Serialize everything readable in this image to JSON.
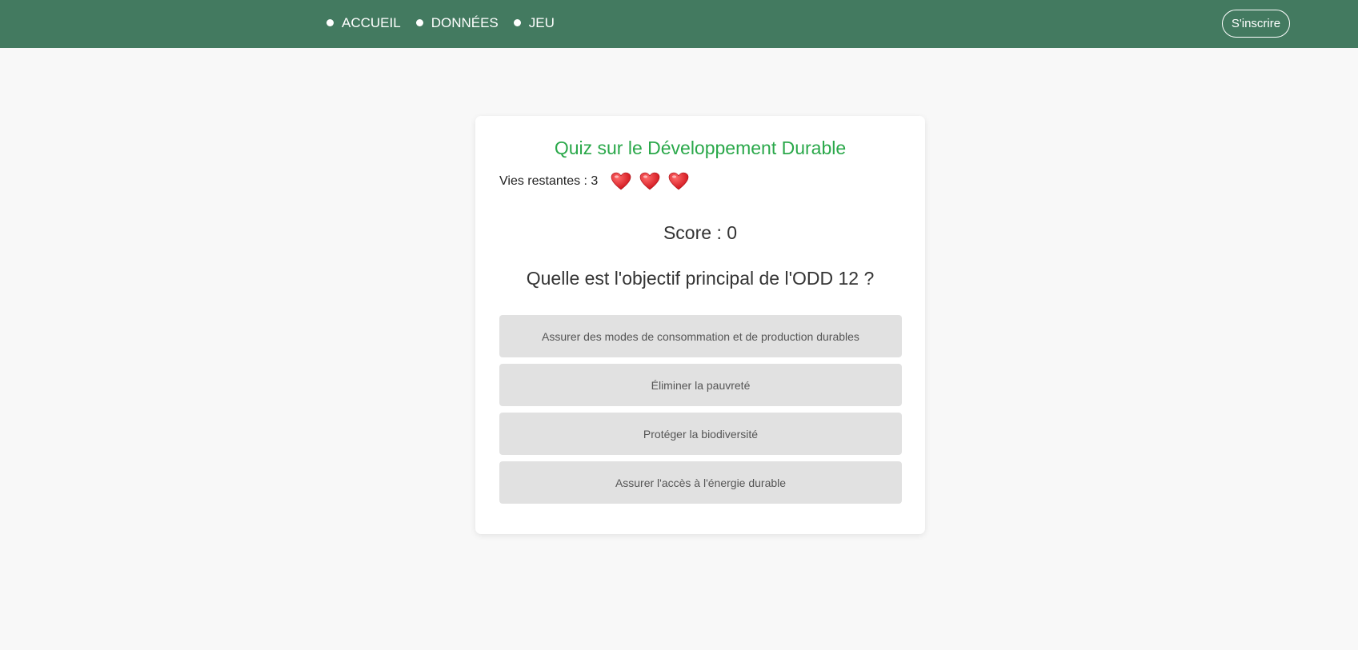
{
  "nav": {
    "items": [
      {
        "label": "ACCUEIL"
      },
      {
        "label": "DONNÉES"
      },
      {
        "label": "JEU"
      }
    ],
    "signup_label": "S'inscrire"
  },
  "quiz": {
    "title": "Quiz sur le Développement Durable",
    "lives_label": "Vies restantes : 3",
    "lives_remaining": 3,
    "score_label": "Score : 0",
    "question": "Quelle est l'objectif principal de l'ODD 12 ?",
    "answers": [
      {
        "label": "Assurer des modes de consommation et de production durables"
      },
      {
        "label": "Éliminer la pauvreté"
      },
      {
        "label": "Protéger la biodiversité"
      },
      {
        "label": "Assurer l'accès à l'énergie durable"
      }
    ]
  },
  "colors": {
    "navbar": "#437a60",
    "title": "#2aa84a",
    "heart": "#e0242c",
    "answer_bg": "#e1e1e1",
    "page_bg": "#f8f8f8"
  }
}
